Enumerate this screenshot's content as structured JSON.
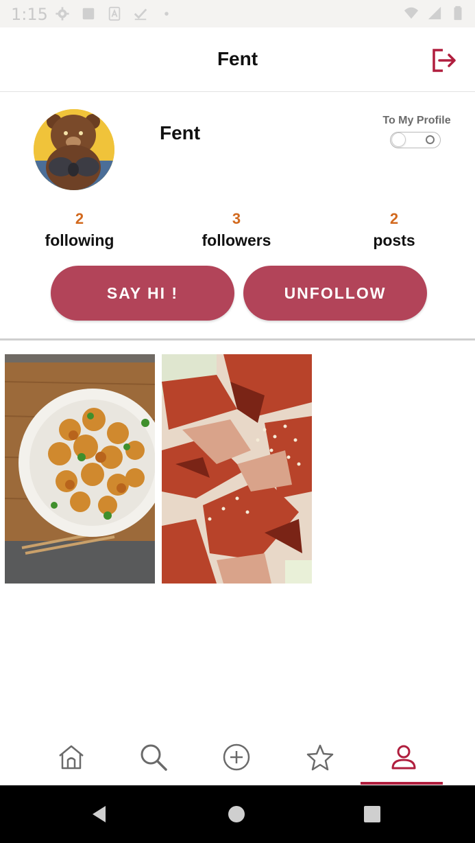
{
  "status_bar": {
    "time": "1:15"
  },
  "app_bar": {
    "title": "Fent"
  },
  "profile": {
    "name": "Fent",
    "toggle_label": "To My Profile",
    "toggle_on": false
  },
  "stats": {
    "following": {
      "count": "2",
      "label": "following"
    },
    "followers": {
      "count": "3",
      "label": "followers"
    },
    "posts": {
      "count": "2",
      "label": "posts"
    }
  },
  "actions": {
    "say_hi_label": "SAY HI !",
    "unfollow_label": "UNFOLLOW"
  },
  "posts": [
    {
      "icon": "orange-chicken-photo"
    },
    {
      "icon": "roast-duck-photo"
    }
  ],
  "bottom_nav": {
    "items": [
      "home-icon",
      "search-icon",
      "add-circle-icon",
      "star-icon",
      "profile-icon"
    ],
    "active_index": 4
  },
  "colors": {
    "accent": "#b24459",
    "brand_red": "#b01e3e",
    "count_orange": "#d2691e"
  }
}
